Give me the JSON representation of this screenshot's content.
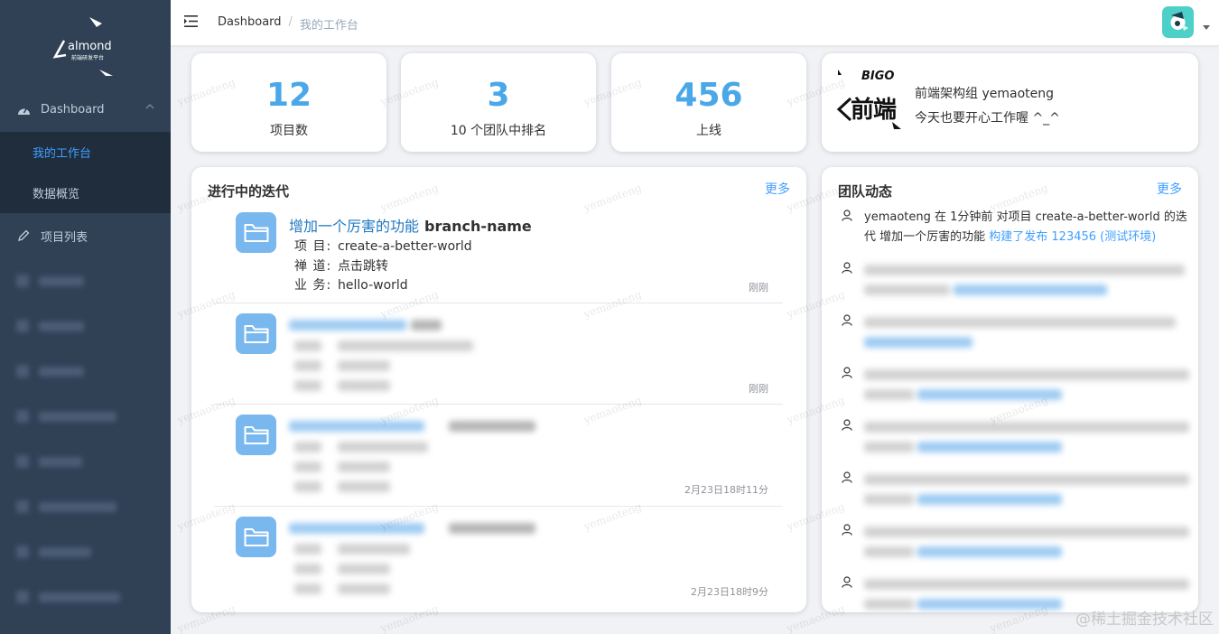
{
  "sidebar": {
    "logo_text": "almond",
    "logo_subtext": "前端研发平台",
    "dashboard_label": "Dashboard",
    "sub_workbench": "我的工作台",
    "sub_overview": "数据概览",
    "project_list": "项目列表"
  },
  "header": {
    "crumb_home": "Dashboard",
    "crumb_sep": "/",
    "crumb_current": "我的工作台"
  },
  "stats": [
    {
      "value": "12",
      "label": "项目数"
    },
    {
      "value": "3",
      "label": "10 个团队中排名"
    },
    {
      "value": "456",
      "label": "上线"
    }
  ],
  "profile": {
    "name": "前端架构组 yemaoteng",
    "greeting": "今天也要开心工作喔 ^_^",
    "logo_top": "BIGO",
    "logo_main": "前端"
  },
  "iterations_panel": {
    "title": "进行中的迭代",
    "more": "更多",
    "first": {
      "title_link": "增加一个厉害的功能",
      "branch": "branch-name",
      "project_key": "项 目:",
      "project_val": "create-a-better-world",
      "lane_key": "禅 道:",
      "lane_val": "点击跳转",
      "biz_key": "业 务:",
      "biz_val": "hello-world",
      "time": "刚刚"
    },
    "times": [
      "刚刚",
      "2月23日18时11分",
      "2月23日18时9分"
    ]
  },
  "activity_panel": {
    "title": "团队动态",
    "more": "更多",
    "first_text": "yemaoteng 在 1分钟前 对项目 create-a-better-world 的迭代 增加一个厉害的功能 ",
    "first_link": "构建了发布 123456 (测试环境)"
  },
  "watermark_text": "yemaoteng",
  "corner_watermark": "@稀土掘金技术社区",
  "colors": {
    "sidebar_bg": "#304156",
    "submenu_bg": "#1f2d3d",
    "accent": "#409eff",
    "stat_value": "#4aa8e8",
    "folder": "#78b8ee"
  }
}
